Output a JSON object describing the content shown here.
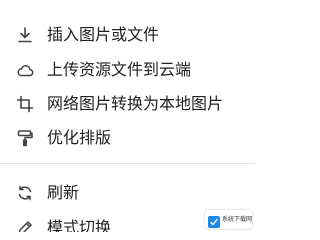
{
  "menu": {
    "items": [
      {
        "label": "插入图片或文件",
        "icon": "download-icon"
      },
      {
        "label": "上传资源文件到云端",
        "icon": "cloud-icon"
      },
      {
        "label": "网络图片转换为本地图片",
        "icon": "crop-icon"
      },
      {
        "label": "优化排版",
        "icon": "paint-roller-icon"
      },
      {
        "label": "刷新",
        "icon": "refresh-icon"
      },
      {
        "label": "模式切换",
        "icon": "pencil-icon"
      }
    ]
  },
  "watermark": {
    "text": "系统下载网"
  },
  "colors": {
    "text": "#222222",
    "icon": "#444444",
    "divider": "#e6e6e6",
    "watermark_blue": "#1e88e5"
  }
}
